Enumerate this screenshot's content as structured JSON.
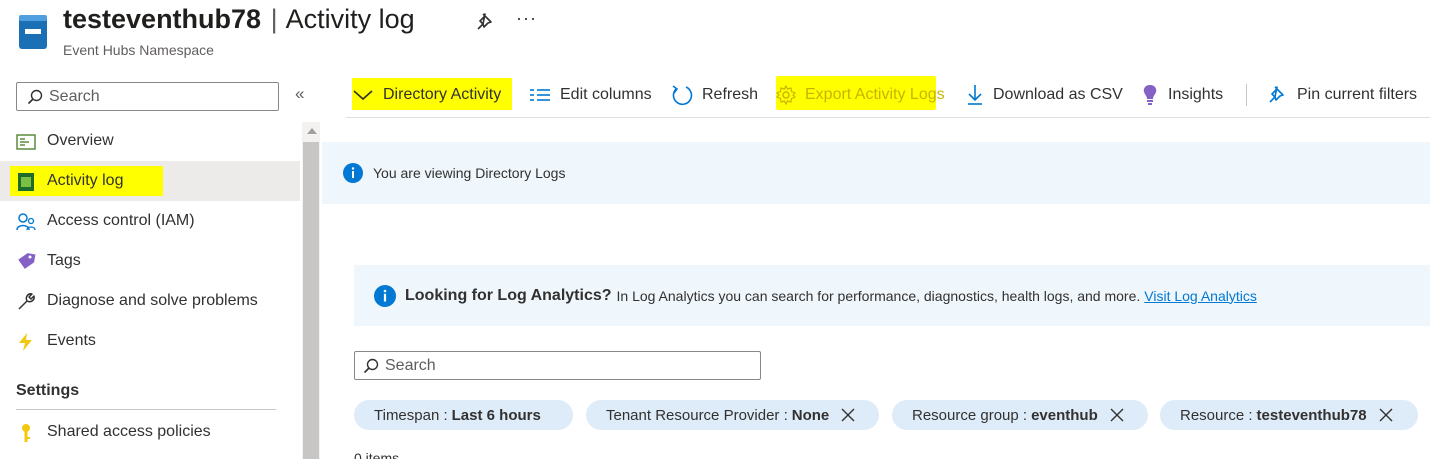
{
  "header": {
    "resource_name": "testeventhub78",
    "separator": "|",
    "page_title": "Activity log",
    "subtitle": "Event Hubs Namespace",
    "more_label": "···"
  },
  "sidebar": {
    "search_placeholder": "Search",
    "collapse_label": "«",
    "items": [
      {
        "label": "Overview",
        "icon": "overview-icon"
      },
      {
        "label": "Activity log",
        "icon": "activity-log-icon",
        "active": true,
        "highlighted": true
      },
      {
        "label": "Access control (IAM)",
        "icon": "iam-icon"
      },
      {
        "label": "Tags",
        "icon": "tag-icon"
      },
      {
        "label": "Diagnose and solve problems",
        "icon": "wrench-icon"
      },
      {
        "label": "Events",
        "icon": "lightning-icon"
      }
    ],
    "settings_heading": "Settings",
    "settings_items": [
      {
        "label": "Shared access policies",
        "icon": "key-icon"
      }
    ]
  },
  "toolbar": {
    "directory_activity": "Directory Activity",
    "edit_columns": "Edit columns",
    "refresh": "Refresh",
    "export_activity_logs": "Export Activity Logs",
    "download_csv": "Download as CSV",
    "insights": "Insights",
    "pin_filters": "Pin current filters"
  },
  "banner_directory": {
    "text": "You are viewing Directory Logs"
  },
  "banner_log_analytics": {
    "title": "Looking for Log Analytics?",
    "text": "In Log Analytics you can search for performance, diagnostics, health logs, and more.",
    "link": "Visit Log Analytics"
  },
  "main_search": {
    "placeholder": "Search"
  },
  "filters": [
    {
      "key": "Timespan :",
      "value": "Last 6 hours",
      "removable": false
    },
    {
      "key": "Tenant Resource Provider :",
      "value": "None",
      "removable": true
    },
    {
      "key": "Resource group :",
      "value": "eventhub",
      "removable": true
    },
    {
      "key": "Resource :",
      "value": "testeventhub78",
      "removable": true
    }
  ],
  "items_count": "0 items",
  "colors": {
    "accent": "#0078d4",
    "highlight": "#ffff00",
    "banner_bg": "#eff6fc",
    "pill_bg": "#deecf9",
    "active_nav_bg": "#edebe9"
  }
}
